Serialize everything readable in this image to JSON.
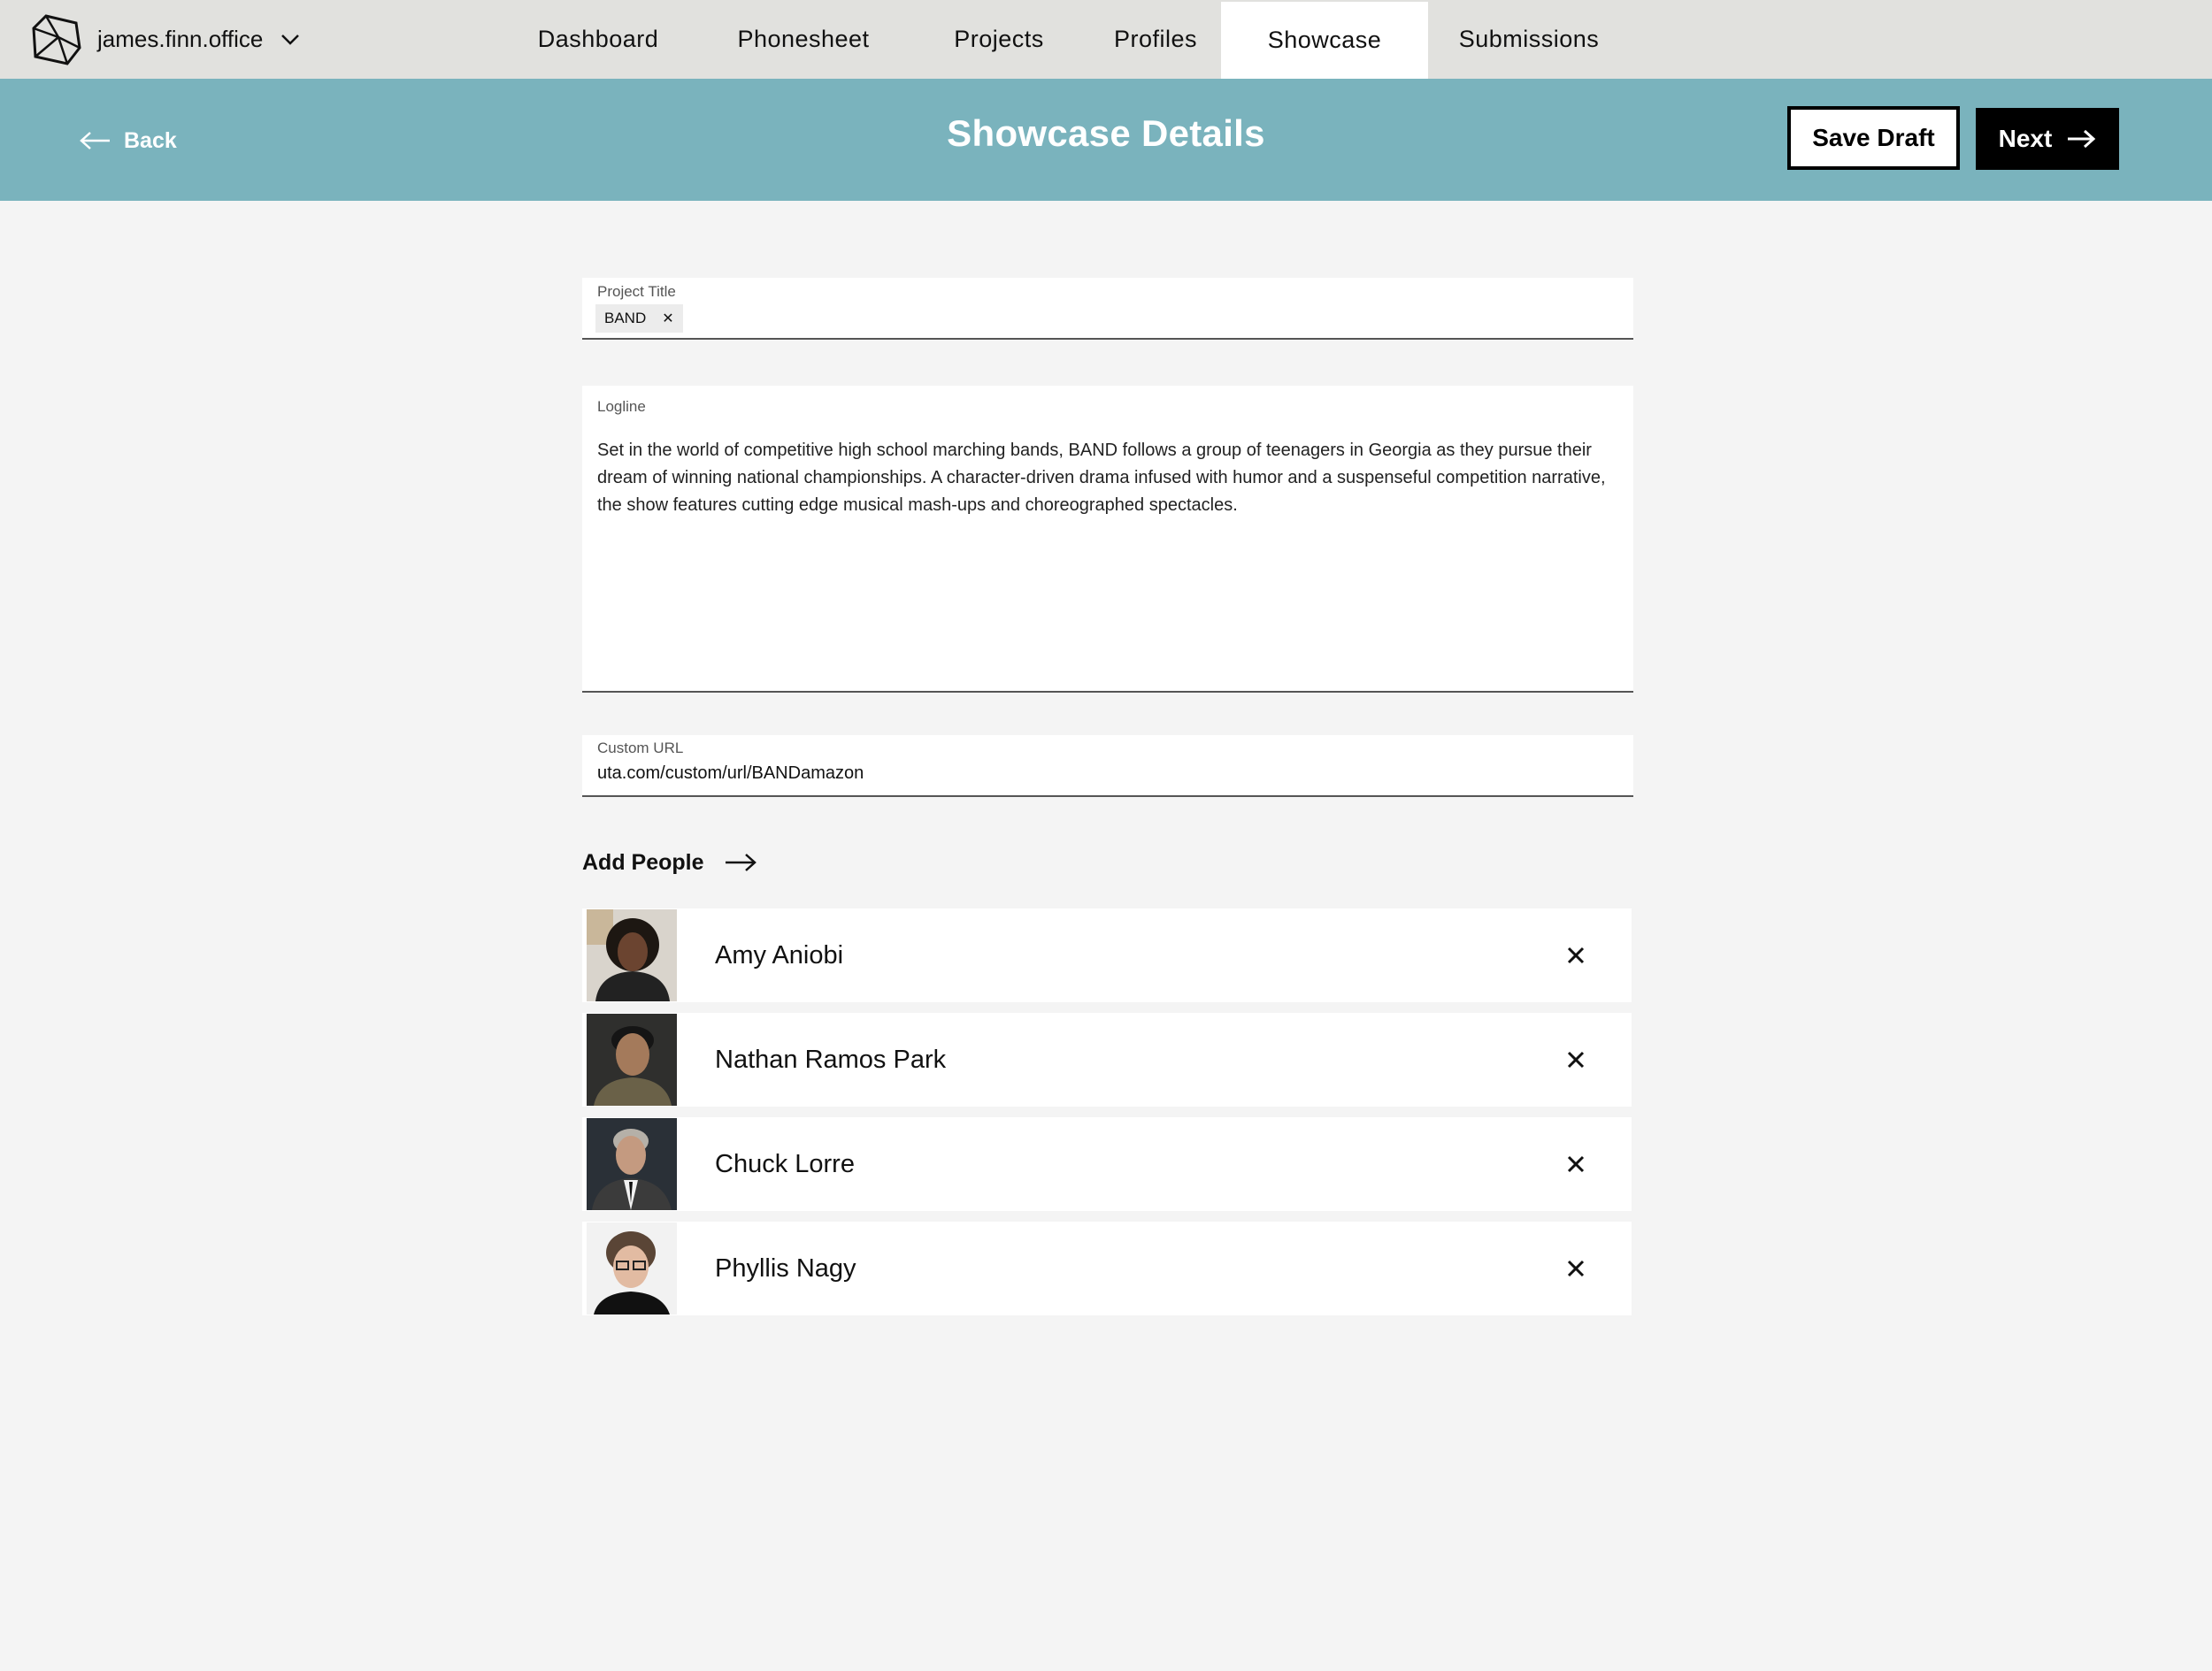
{
  "account": {
    "name": "james.finn.office"
  },
  "nav": {
    "tabs": [
      {
        "label": "Dashboard"
      },
      {
        "label": "Phonesheet"
      },
      {
        "label": "Projects"
      },
      {
        "label": "Profiles"
      },
      {
        "label": "Showcase"
      },
      {
        "label": "Submissions"
      }
    ],
    "active": "Showcase"
  },
  "header": {
    "back_label": "Back",
    "title": "Showcase Details",
    "save_draft_label": "Save Draft",
    "next_label": "Next",
    "band_color": "#7ab3bd"
  },
  "form": {
    "project_title": {
      "label": "Project Title",
      "chip": "BAND"
    },
    "logline": {
      "label": "Logline",
      "value": "Set in the world of competitive high school marching bands, BAND follows a group of teenagers in Georgia as they pursue their dream of winning national championships. A character-driven drama infused with humor and a suspenseful competition narrative, the show features cutting edge musical mash-ups and choreographed spectacles."
    },
    "custom_url": {
      "label": "Custom URL",
      "value": "uta.com/custom/url/BANDamazon"
    }
  },
  "people": {
    "add_label": "Add People",
    "items": [
      {
        "name": "Amy Aniobi"
      },
      {
        "name": "Nathan Ramos Park"
      },
      {
        "name": "Chuck Lorre"
      },
      {
        "name": "Phyllis Nagy"
      }
    ]
  },
  "icons": {
    "logo": "cube-logo-icon",
    "account_toggle": "chevron-down-icon",
    "back": "arrow-left-icon",
    "next": "arrow-right-icon",
    "add_people": "arrow-right-icon",
    "chip_remove": "close-icon",
    "person_remove": "close-icon"
  }
}
